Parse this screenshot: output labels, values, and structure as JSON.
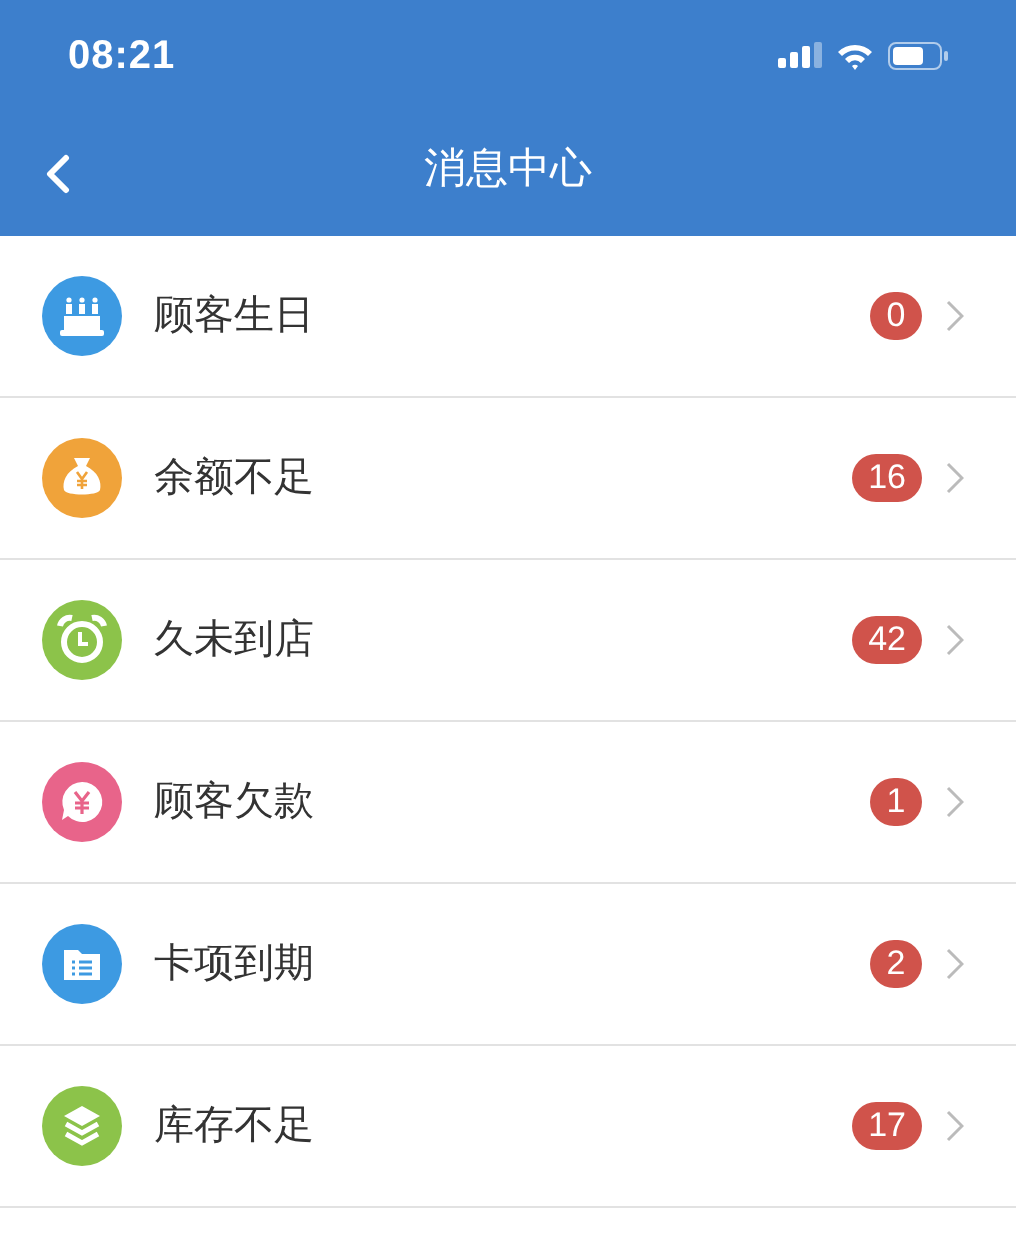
{
  "status_bar": {
    "time": "08:21"
  },
  "nav_bar": {
    "title": "消息中心"
  },
  "items": [
    {
      "kind": "cake",
      "color": "#3d9ae2",
      "label": "顾客生日",
      "count": "0"
    },
    {
      "kind": "moneybag",
      "color": "#f0a33a",
      "label": "余额不足",
      "count": "16"
    },
    {
      "kind": "clock",
      "color": "#8cc34a",
      "label": "久未到店",
      "count": "42"
    },
    {
      "kind": "yen",
      "color": "#e8648a",
      "label": "顾客欠款",
      "count": "1"
    },
    {
      "kind": "folder",
      "color": "#3d9ae2",
      "label": "卡项到期",
      "count": "2"
    },
    {
      "kind": "layers",
      "color": "#8cc34a",
      "label": "库存不足",
      "count": "17"
    }
  ]
}
